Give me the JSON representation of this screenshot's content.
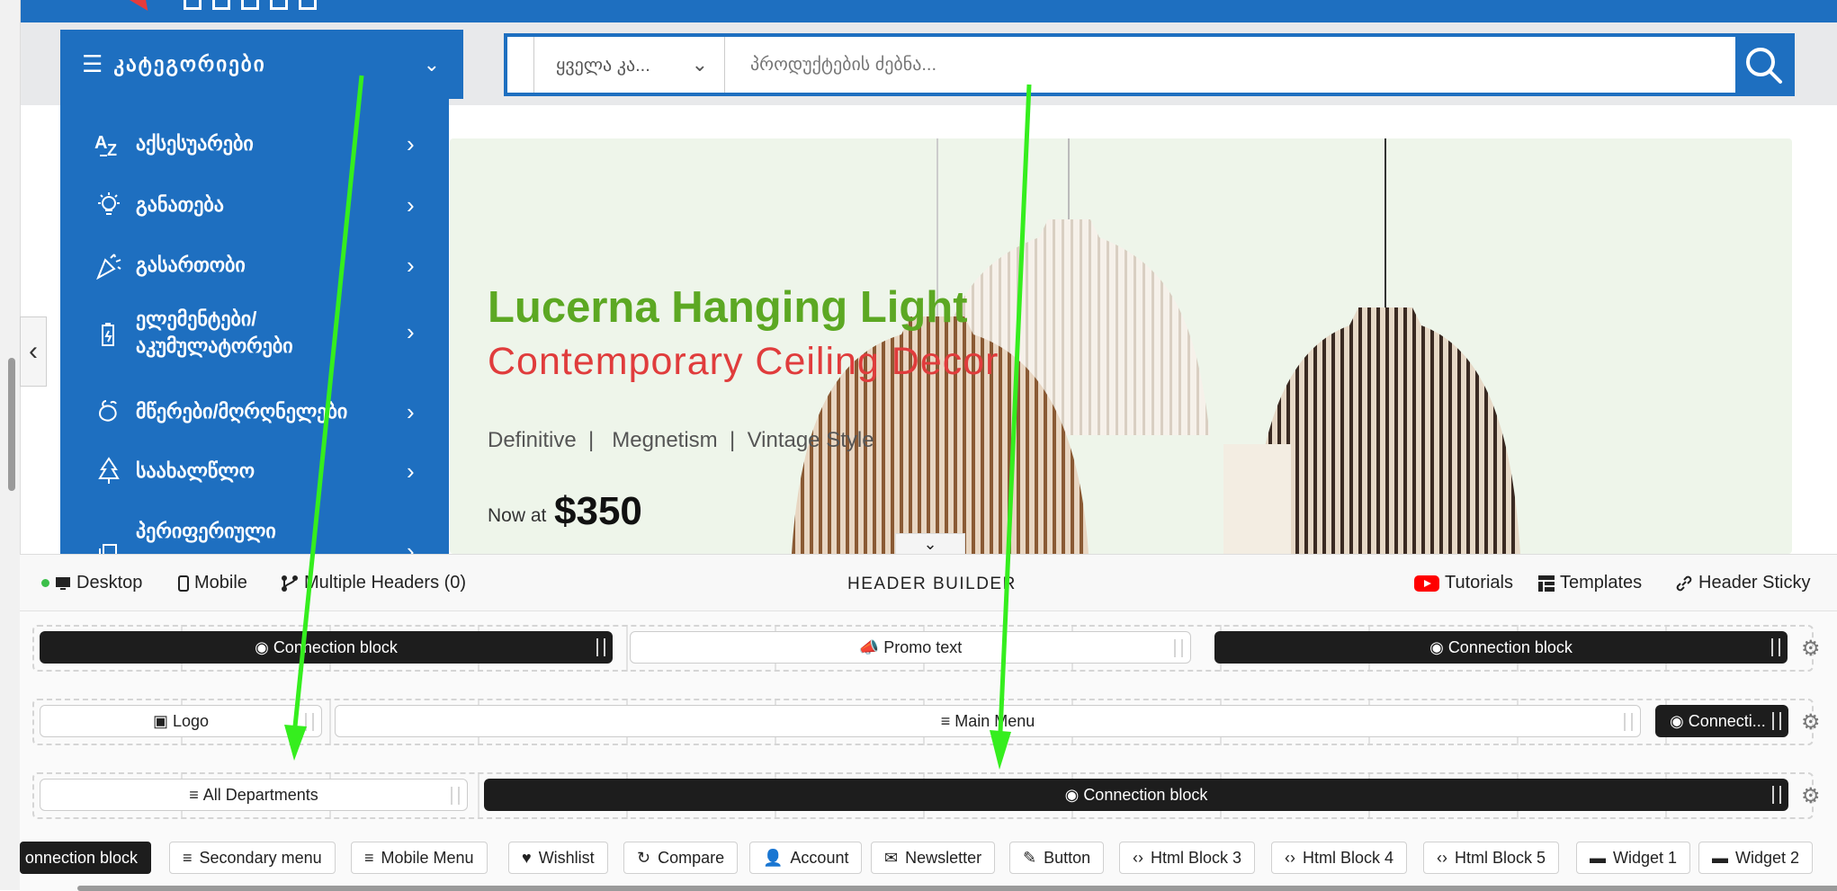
{
  "categories": {
    "title": "კატეგორიები",
    "items": [
      {
        "label": "აქსესუარები",
        "icon": "az-icon"
      },
      {
        "label": "განათება",
        "icon": "bulb-icon"
      },
      {
        "label": "გასართობი",
        "icon": "party-icon"
      },
      {
        "label": "ელემენტები/ აკუმულატორები",
        "icon": "battery-icon"
      },
      {
        "label": "მწერები/მღრღნელები",
        "icon": "bug-icon"
      },
      {
        "label": "საახალწლო",
        "icon": "tree-icon"
      },
      {
        "label": "პერიფერიული",
        "icon": "device-icon"
      }
    ]
  },
  "search": {
    "category_value": "ყველა კა...",
    "placeholder": "პროდუქტების ძებნა..."
  },
  "hero": {
    "title": "Lucerna Hanging Light",
    "subtitle": "Contemporary Ceiling Decor",
    "features": "Definitive  |   Megnetism  |  Vintage Style",
    "price_label": "Now at",
    "price": "$350"
  },
  "builder": {
    "title": "HEADER BUILDER",
    "desktop": "Desktop",
    "mobile": "Mobile",
    "multiple_headers": "Multiple Headers (0)",
    "tutorials": "Tutorials",
    "templates": "Templates",
    "header_sticky": "Header Sticky",
    "row1": {
      "left": "Connection block",
      "center": "Promo text",
      "right": "Connection block"
    },
    "row2": {
      "left": "Logo",
      "center": "Main Menu",
      "right": "Connecti..."
    },
    "row3": {
      "left": "All Departments",
      "center": "Connection block"
    },
    "chips": [
      "onnection block",
      "Secondary menu",
      "Mobile Menu",
      "Wishlist",
      "Compare",
      "Account",
      "Newsletter",
      "Button",
      "Html Block 3",
      "Html Block 4",
      "Html Block 5",
      "Widget 1",
      "Widget 2"
    ]
  },
  "colors": {
    "brand_blue": "#1e6fc0",
    "title_green": "#5ca823",
    "subtitle_red": "#e03c3c",
    "arrow_green": "#35ee1e",
    "dark_block": "#1d1d1d"
  }
}
